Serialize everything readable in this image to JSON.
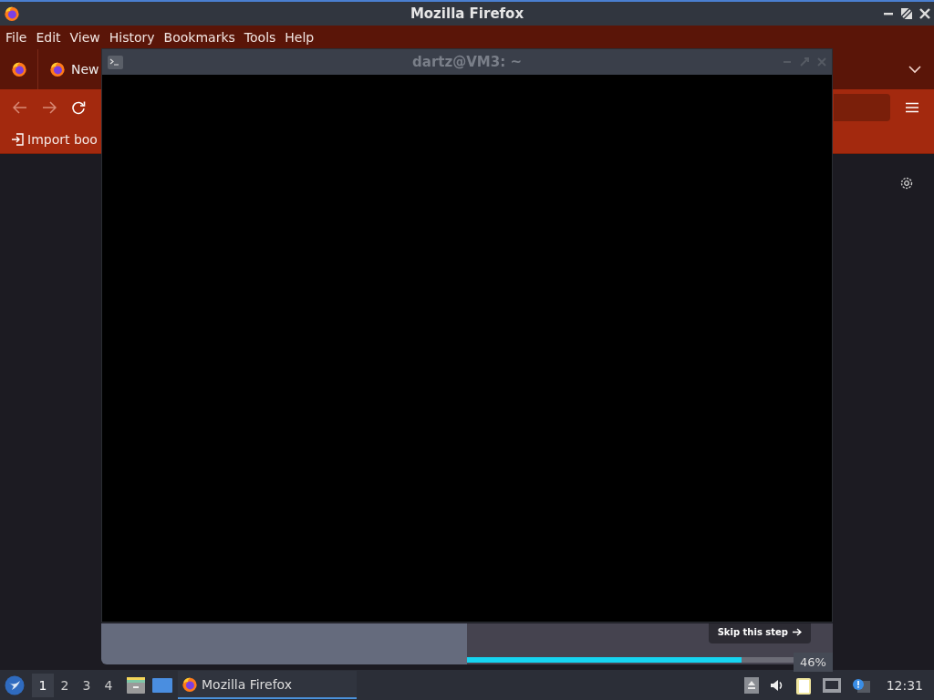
{
  "firefox": {
    "title": "Mozilla Firefox",
    "menu": [
      "File",
      "Edit",
      "View",
      "History",
      "Bookmarks",
      "Tools",
      "Help"
    ],
    "tab_label": "New",
    "bookmark": "Import boo"
  },
  "onboarding": {
    "skip_button": "Skip this step",
    "progress": {
      "level": 0.84
    },
    "tooltip": "46%"
  },
  "terminal": {
    "title": "dartz@VM3: ~"
  },
  "taskbar": {
    "workspaces": [
      {
        "label": "1",
        "selected": true
      },
      {
        "label": "2",
        "selected": false
      },
      {
        "label": "3",
        "selected": false
      },
      {
        "label": "4",
        "selected": false
      }
    ],
    "tasks": [
      {
        "label": "Mozilla Firefox",
        "selected": true
      }
    ],
    "clock": "12:31"
  }
}
